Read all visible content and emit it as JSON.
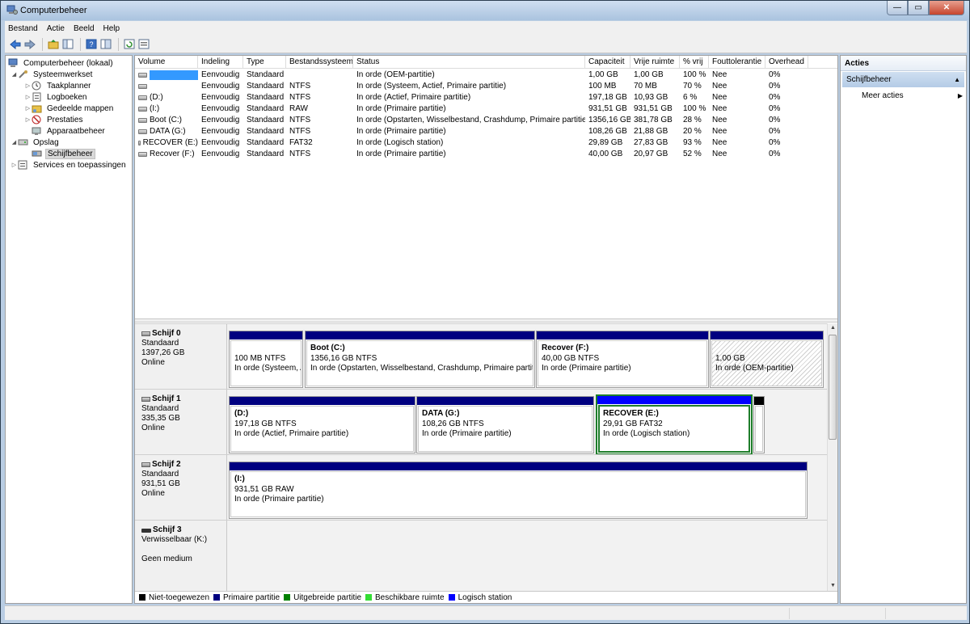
{
  "window": {
    "title": "Computerbeheer",
    "buttons": {
      "minimize": "—",
      "maximize": "▭",
      "close": "✕"
    }
  },
  "menu": [
    "Bestand",
    "Actie",
    "Beeld",
    "Help"
  ],
  "toolbar_icons": [
    "back-arrow-icon",
    "forward-arrow-icon",
    "up-folder-icon",
    "show-tree-icon",
    "help-icon",
    "properties-icon",
    "refresh-icon",
    "export-icon"
  ],
  "tree": {
    "root": "Computerbeheer (lokaal)",
    "systeemwerkset": "Systeemwerkset",
    "taakplanner": "Taakplanner",
    "logboeken": "Logboeken",
    "gedeelde_mappen": "Gedeelde mappen",
    "prestaties": "Prestaties",
    "apparaatbeheer": "Apparaatbeheer",
    "opslag": "Opslag",
    "schijfbeheer": "Schijfbeheer",
    "services": "Services en toepassingen"
  },
  "volume_table": {
    "columns": [
      "Volume",
      "Indeling",
      "Type",
      "Bestandssysteem",
      "Status",
      "Capaciteit",
      "Vrije ruimte",
      "% vrij",
      "Fouttolerantie",
      "Overhead"
    ],
    "rows": [
      [
        "",
        "Eenvoudig",
        "Standaard",
        "",
        "In orde (OEM-partitie)",
        "1,00 GB",
        "1,00 GB",
        "100 %",
        "Nee",
        "0%"
      ],
      [
        "",
        "Eenvoudig",
        "Standaard",
        "NTFS",
        "In orde (Systeem, Actief, Primaire partitie)",
        "100 MB",
        "70 MB",
        "70 %",
        "Nee",
        "0%"
      ],
      [
        "(D:)",
        "Eenvoudig",
        "Standaard",
        "NTFS",
        "In orde (Actief, Primaire partitie)",
        "197,18 GB",
        "10,93 GB",
        "6 %",
        "Nee",
        "0%"
      ],
      [
        "(I:)",
        "Eenvoudig",
        "Standaard",
        "RAW",
        "In orde (Primaire partitie)",
        "931,51 GB",
        "931,51 GB",
        "100 %",
        "Nee",
        "0%"
      ],
      [
        "Boot (C:)",
        "Eenvoudig",
        "Standaard",
        "NTFS",
        "In orde (Opstarten, Wisselbestand, Crashdump, Primaire partitie)",
        "1356,16 GB",
        "381,78 GB",
        "28 %",
        "Nee",
        "0%"
      ],
      [
        "DATA (G:)",
        "Eenvoudig",
        "Standaard",
        "NTFS",
        "In orde (Primaire partitie)",
        "108,26 GB",
        "21,88 GB",
        "20 %",
        "Nee",
        "0%"
      ],
      [
        "RECOVER (E:)",
        "Eenvoudig",
        "Standaard",
        "FAT32",
        "In orde (Logisch station)",
        "29,89 GB",
        "27,83 GB",
        "93 %",
        "Nee",
        "0%"
      ],
      [
        "Recover (F:)",
        "Eenvoudig",
        "Standaard",
        "NTFS",
        "In orde (Primaire partitie)",
        "40,00 GB",
        "20,97 GB",
        "52 %",
        "Nee",
        "0%"
      ]
    ]
  },
  "disks": [
    {
      "name": "Schijf 0",
      "type": "Standaard",
      "size": "1397,26 GB",
      "state": "Online",
      "partitions": [
        {
          "name": "",
          "line1": "100 MB NTFS",
          "line2": "In orde (Systeem, A",
          "kind": "primary"
        },
        {
          "name": "Boot  (C:)",
          "line1": "1356,16 GB NTFS",
          "line2": "In orde (Opstarten, Wisselbestand, Crashdump, Primaire partitie",
          "kind": "primary"
        },
        {
          "name": "Recover  (F:)",
          "line1": "40,00 GB NTFS",
          "line2": "In orde (Primaire partitie)",
          "kind": "primary"
        },
        {
          "name": "",
          "line1": "1,00 GB",
          "line2": "In orde (OEM-partitie)",
          "kind": "oem"
        }
      ]
    },
    {
      "name": "Schijf 1",
      "type": "Standaard",
      "size": "335,35 GB",
      "state": "Online",
      "partitions": [
        {
          "name": "(D:)",
          "line1": "197,18 GB NTFS",
          "line2": "In orde (Actief, Primaire partitie)",
          "kind": "primary"
        },
        {
          "name": "DATA  (G:)",
          "line1": "108,26 GB NTFS",
          "line2": "In orde (Primaire partitie)",
          "kind": "primary"
        },
        {
          "name": "RECOVER  (E:)",
          "line1": "29,91 GB FAT32",
          "line2": "In orde (Logisch station)",
          "kind": "logical"
        },
        {
          "name": "",
          "line1": "",
          "line2": "",
          "kind": "unallocated"
        }
      ]
    },
    {
      "name": "Schijf 2",
      "type": "Standaard",
      "size": "931,51 GB",
      "state": "Online",
      "partitions": [
        {
          "name": "(I:)",
          "line1": "931,51 GB RAW",
          "line2": "In orde (Primaire partitie)",
          "kind": "primary"
        }
      ]
    },
    {
      "name": "Schijf 3",
      "type": "Verwisselbaar (K:)",
      "size": "",
      "state": "Geen medium",
      "partitions": []
    }
  ],
  "legend": [
    {
      "label": "Niet-toegewezen",
      "color": "#000000"
    },
    {
      "label": "Primaire partitie",
      "color": "#000080"
    },
    {
      "label": "Uitgebreide partitie",
      "color": "#008000"
    },
    {
      "label": "Beschikbare ruimte",
      "color": "#33dd33"
    },
    {
      "label": "Logisch station",
      "color": "#0000ff"
    }
  ],
  "colors": {
    "primary": "#000080",
    "logical": "#0000ff",
    "unallocated": "#000000",
    "selection": "#1e7d2a"
  },
  "actions": {
    "header": "Acties",
    "section": "Schijfbeheer",
    "more": "Meer acties"
  }
}
